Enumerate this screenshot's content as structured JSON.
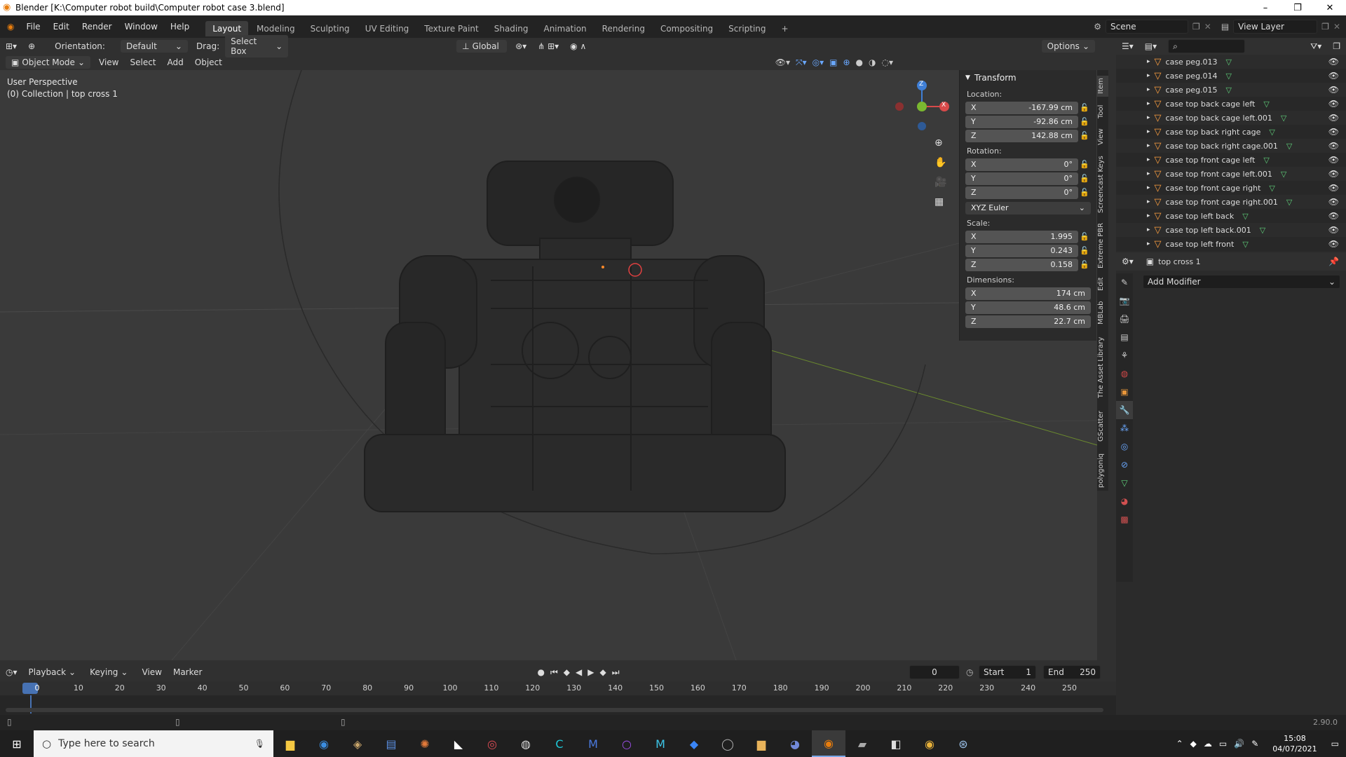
{
  "window": {
    "title": "Blender [K:\\Computer robot build\\Computer robot case 3.blend]",
    "minimize": "–",
    "maximize": "❐",
    "close": "✕"
  },
  "menu": [
    "File",
    "Edit",
    "Render",
    "Window",
    "Help"
  ],
  "workspace_tabs": [
    "Layout",
    "Modeling",
    "Sculpting",
    "UV Editing",
    "Texture Paint",
    "Shading",
    "Animation",
    "Rendering",
    "Compositing",
    "Scripting"
  ],
  "active_tab": "Layout",
  "scene": {
    "label": "Scene",
    "view_layer": "View Layer"
  },
  "tool_header": {
    "orientation_label": "Orientation:",
    "orientation_value": "Default",
    "drag_label": "Drag:",
    "drag_value": "Select Box",
    "transform_orientation": "Global",
    "options": "Options"
  },
  "viewport_header": {
    "mode": "Object Mode",
    "menus": [
      "View",
      "Select",
      "Add",
      "Object"
    ]
  },
  "viewport": {
    "perspective": "User Perspective",
    "collection": "(0) Collection | top cross 1",
    "gizmo": {
      "z": "Z",
      "x": "X"
    }
  },
  "npanel": {
    "section": "Transform",
    "location_label": "Location:",
    "location": [
      {
        "axis": "X",
        "value": "-167.99 cm"
      },
      {
        "axis": "Y",
        "value": "-92.86 cm"
      },
      {
        "axis": "Z",
        "value": "142.88 cm"
      }
    ],
    "rotation_label": "Rotation:",
    "rotation": [
      {
        "axis": "X",
        "value": "0°"
      },
      {
        "axis": "Y",
        "value": "0°"
      },
      {
        "axis": "Z",
        "value": "0°"
      }
    ],
    "rotation_mode": "XYZ Euler",
    "scale_label": "Scale:",
    "scale": [
      {
        "axis": "X",
        "value": "1.995"
      },
      {
        "axis": "Y",
        "value": "0.243"
      },
      {
        "axis": "Z",
        "value": "0.158"
      }
    ],
    "dimensions_label": "Dimensions:",
    "dimensions": [
      {
        "axis": "X",
        "value": "174 cm"
      },
      {
        "axis": "Y",
        "value": "48.6 cm"
      },
      {
        "axis": "Z",
        "value": "22.7 cm"
      }
    ]
  },
  "sidebar_tabs": [
    "Item",
    "Tool",
    "View",
    "Screencast Keys",
    "Extreme PBR",
    "Edit",
    "MBLab",
    "The Asset Library",
    "GScatter",
    "polygoniq"
  ],
  "outliner": {
    "items": [
      "case peg.013",
      "case peg.014",
      "case peg.015",
      "case top back cage left",
      "case top back cage left.001",
      "case top back right cage",
      "case top back right cage.001",
      "case top front cage left",
      "case top front cage left.001",
      "case top front cage right",
      "case top front cage right.001",
      "case top left back",
      "case top left back.001",
      "case top left front"
    ]
  },
  "properties": {
    "object_name": "top cross 1",
    "add_modifier": "Add Modifier"
  },
  "timeline": {
    "menus": [
      "Playback",
      "Keying",
      "View",
      "Marker"
    ],
    "current_frame": "0",
    "start_label": "Start",
    "start": "1",
    "end_label": "End",
    "end": "250",
    "ticks": [
      "0",
      "10",
      "20",
      "30",
      "40",
      "50",
      "60",
      "70",
      "80",
      "90",
      "100",
      "110",
      "120",
      "130",
      "140",
      "150",
      "160",
      "170",
      "180",
      "190",
      "200",
      "210",
      "220",
      "230",
      "240",
      "250"
    ]
  },
  "status": {
    "version": "2.90.0"
  },
  "taskbar": {
    "search_placeholder": "Type here to search",
    "time": "15:08",
    "date": "04/07/2021"
  }
}
